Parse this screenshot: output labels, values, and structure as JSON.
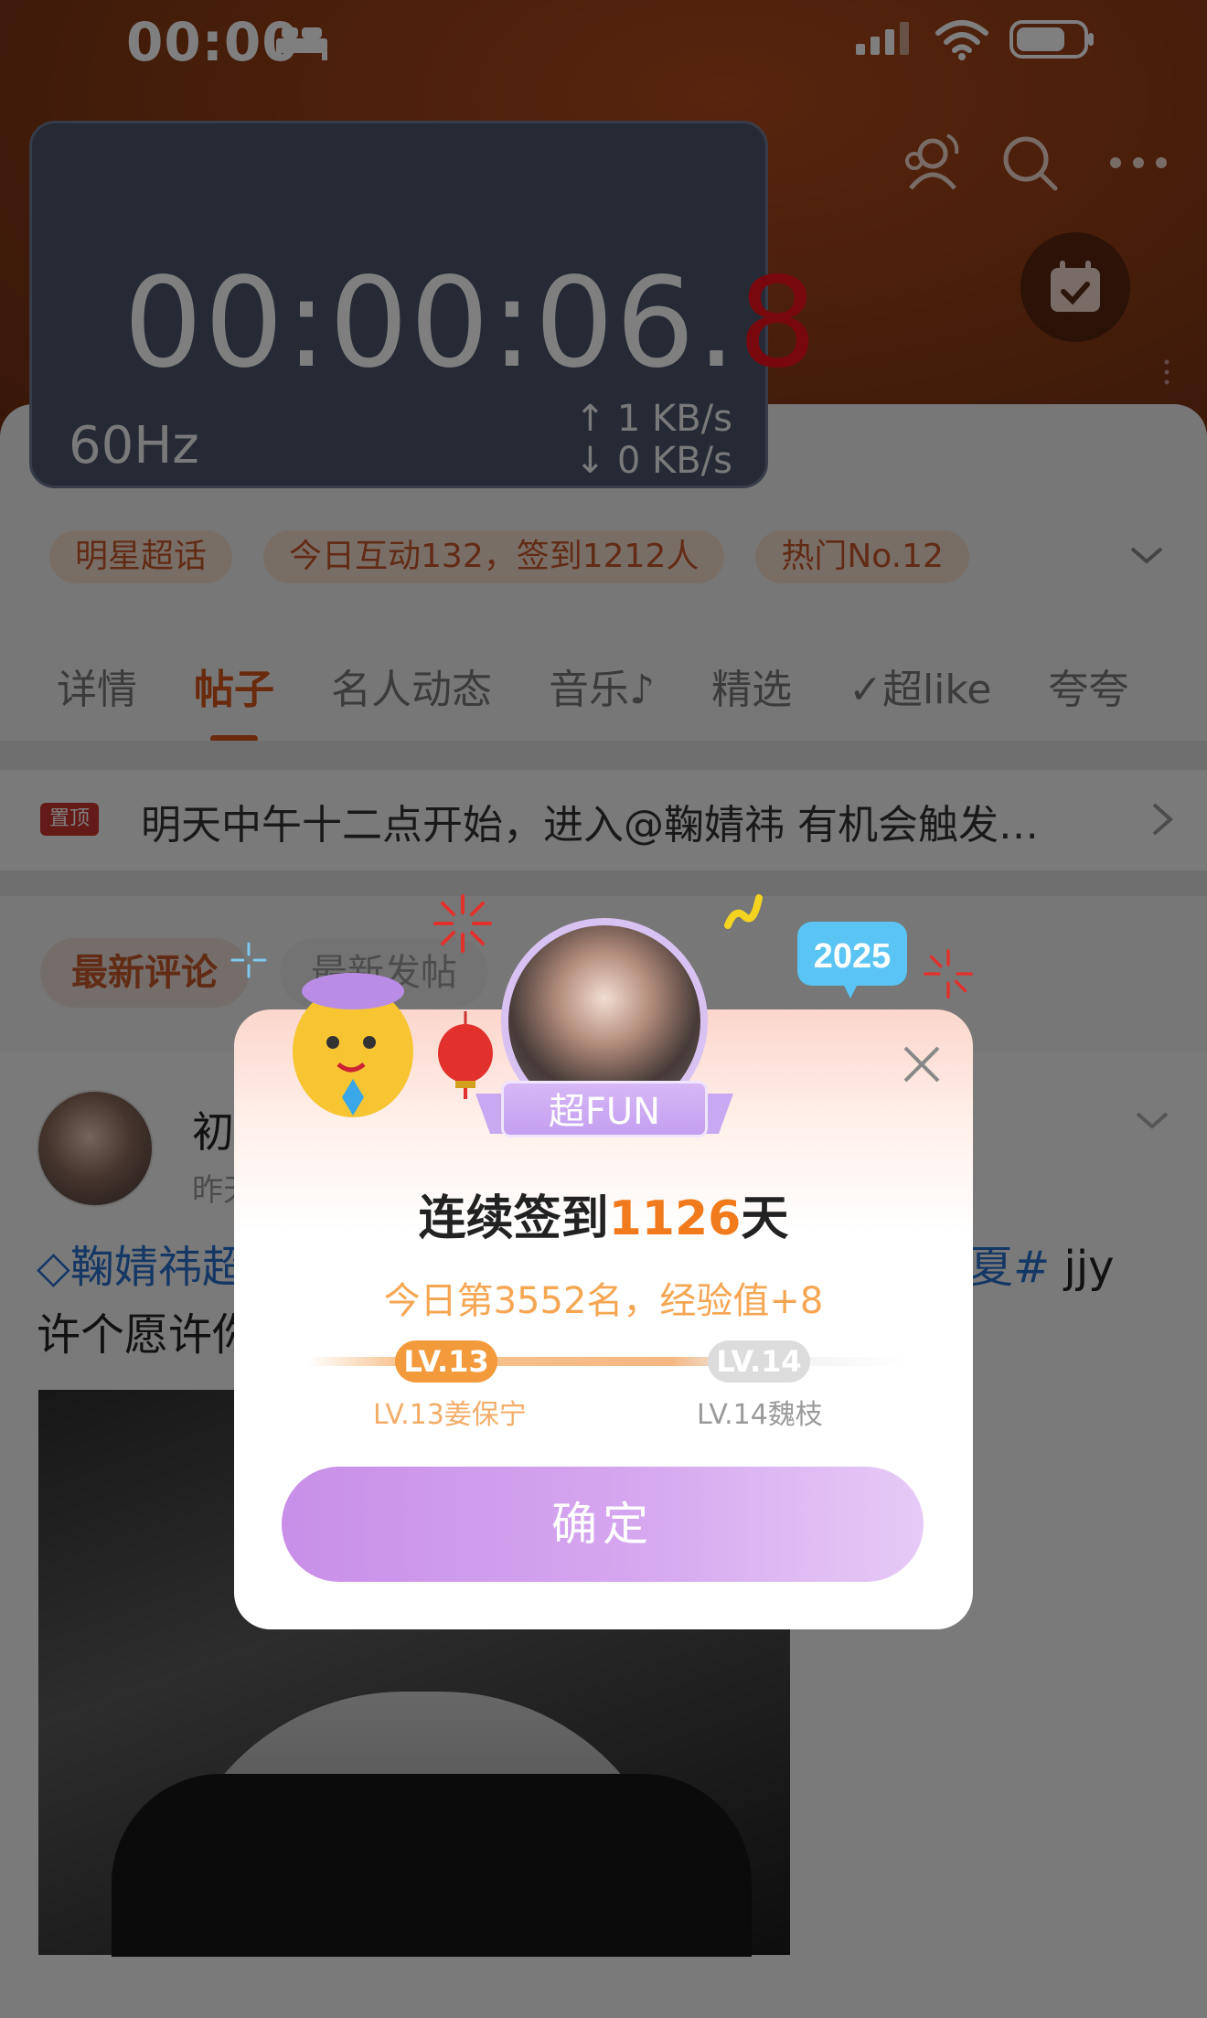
{
  "status_bar": {
    "time": "00:00"
  },
  "timer_overlay": {
    "time_main": "00:00:06.",
    "time_tenths": "8",
    "refresh_rate": "60Hz",
    "upload": "↑ 1 KB/s",
    "download": "↓ 0 KB/s"
  },
  "tags": [
    "明星超话",
    "今日互动132，签到1212人",
    "热门No.12"
  ],
  "tabs": [
    {
      "label": "详情"
    },
    {
      "label": "帖子",
      "active": true
    },
    {
      "label": "名人动态"
    },
    {
      "label": "音乐♪"
    },
    {
      "label": "精选"
    },
    {
      "label": "✓超like"
    },
    {
      "label": "夸夸"
    }
  ],
  "pinned": {
    "badge": "置顶",
    "text": "明天中午十二点开始，进入@鞠婧祎 有机会触发…"
  },
  "filters": [
    "最新评论",
    "最新发帖"
  ],
  "post": {
    "author_initial": "初",
    "time_partial": "昨天",
    "line1_start": "◇鞠婧祎超",
    "line1_end_tag": "夏#",
    "line1_end_text": " jjy",
    "line2": "许个愿许你"
  },
  "dialog": {
    "badge": "超FUN",
    "title_prefix": "连续签到",
    "streak_days": "1126",
    "title_suffix": "天",
    "subtitle": "今日第3552名，经验值+8",
    "level_current": "LV.13",
    "level_current_label": "LV.13姜保宁",
    "level_next": "LV.14",
    "level_next_label": "LV.14魏枝",
    "confirm_label": "确定",
    "decoration_badge": "2025"
  },
  "colors": {
    "accent": "#d2541a",
    "streak": "#f07a1c",
    "confirm_gradient_start": "#c88fe8",
    "timer_bg": "#4a5468"
  }
}
